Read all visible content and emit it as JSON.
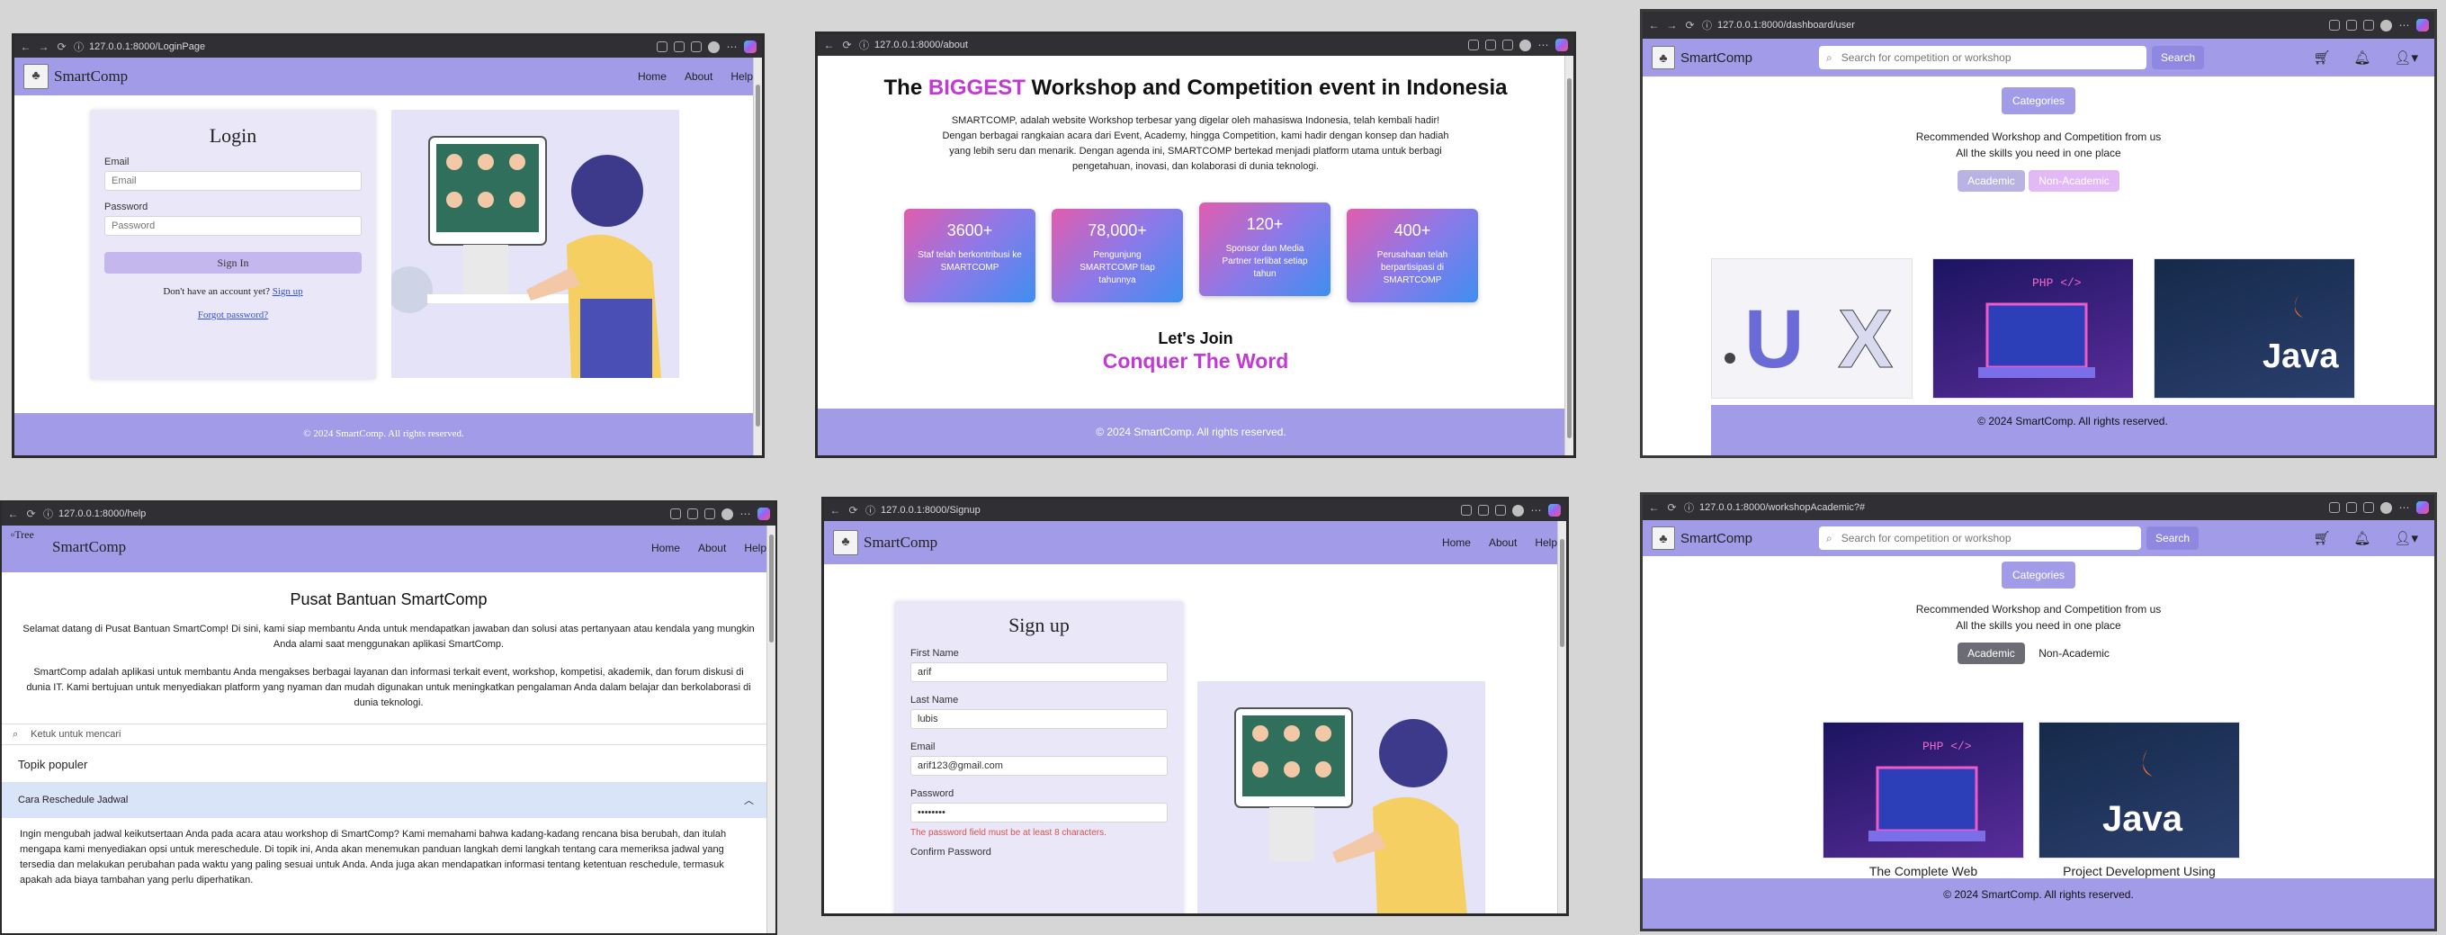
{
  "windows": {
    "login": {
      "url": "127.0.0.1:8000/LoginPage",
      "brand": "SmartComp",
      "nav": [
        "Home",
        "About",
        "Help"
      ],
      "title": "Login",
      "email_label": "Email",
      "email_placeholder": "Email",
      "password_label": "Password",
      "password_placeholder": "Password",
      "submit": "Sign In",
      "no_account": "Don't have an account yet?",
      "signup_link": "Sign up",
      "forgot": "Forgot password?",
      "footer": "© 2024 SmartComp. All rights reserved."
    },
    "about": {
      "url": "127.0.0.1:8000/about",
      "heading_pre": "The ",
      "heading_hl": "BIGGEST",
      "heading_post": " Workshop and Competition event in Indonesia",
      "paragraph": "SMARTCOMP, adalah website Workshop terbesar yang digelar oleh mahasiswa Indonesia, telah kembali hadir! Dengan berbagai rangkaian acara dari Event, Academy, hingga Competition, kami hadir dengan konsep dan hadiah yang lebih seru dan menarik. Dengan agenda ini, SMARTCOMP bertekad menjadi platform utama untuk berbagi pengetahuan, inovasi, dan kolaborasi di dunia teknologi.",
      "stats": [
        {
          "num": "3600+",
          "text": "Staf telah berkontribusi ke SMARTCOMP"
        },
        {
          "num": "78,000+",
          "text": "Pengunjung SMARTCOMP tiap tahunnya"
        },
        {
          "num": "120+",
          "text": "Sponsor dan Media Partner terlibat setiap tahun"
        },
        {
          "num": "400+",
          "text": "Perusahaan telah berpartisipasi di SMARTCOMP"
        }
      ],
      "join": "Let's Join",
      "conquer": "Conquer The Word",
      "footer": "© 2024 SmartComp. All rights reserved."
    },
    "dashboard": {
      "url": "127.0.0.1:8000/dashboard/user",
      "brand": "SmartComp",
      "search_placeholder": "Search for competition or workshop",
      "search_btn": "Search",
      "categories": "Categories",
      "rec1": "Recommended Workshop and Competition from us",
      "rec2": "All the skills you need in one place",
      "tab_academic": "Academic",
      "tab_nonacademic": "Non-Academic",
      "footer": "© 2024 SmartComp. All rights reserved."
    },
    "help": {
      "url": "127.0.0.1:8000/help",
      "logo_alt": "Tree",
      "brand": "SmartComp",
      "nav": [
        "Home",
        "About",
        "Help"
      ],
      "title": "Pusat Bantuan SmartComp",
      "p1": "Selamat datang di Pusat Bantuan SmartComp! Di sini, kami siap membantu Anda untuk mendapatkan jawaban dan solusi atas pertanyaan atau kendala yang mungkin Anda alami saat menggunakan aplikasi SmartComp.",
      "p2": "SmartComp adalah aplikasi untuk membantu Anda mengakses berbagai layanan dan informasi terkait event, workshop, kompetisi, akademik, dan forum diskusi di dunia IT. Kami bertujuan untuk menyediakan platform yang nyaman dan mudah digunakan untuk meningkatkan pengalaman Anda dalam belajar dan berkolaborasi di dunia teknologi.",
      "search_placeholder": "Ketuk untuk mencari",
      "popular": "Topik populer",
      "faq_title": "Cara Reschedule Jadwal",
      "faq_body": "Ingin mengubah jadwal keikutsertaan Anda pada acara atau workshop di SmartComp? Kami memahami bahwa kadang-kadang rencana bisa berubah, dan itulah mengapa kami menyediakan opsi untuk mereschedule. Di topik ini, Anda akan menemukan panduan langkah demi langkah tentang cara memeriksa jadwal yang tersedia dan melakukan perubahan pada waktu yang paling sesuai untuk Anda. Anda juga akan mendapatkan informasi tentang ketentuan reschedule, termasuk apakah ada biaya tambahan yang perlu diperhatikan."
    },
    "signup": {
      "url": "127.0.0.1:8000/Signup",
      "brand": "SmartComp",
      "nav": [
        "Home",
        "About",
        "Help"
      ],
      "title": "Sign up",
      "first_label": "First Name",
      "first_value": "arif",
      "last_label": "Last Name",
      "last_value": "lubis",
      "email_label": "Email",
      "email_value": "arif123@gmail.com",
      "password_label": "Password",
      "password_value": "••••••••",
      "error": "The password field must be at least 8 characters.",
      "confirm_label": "Confirm Password"
    },
    "academic": {
      "url": "127.0.0.1:8000/workshopAcademic?#",
      "brand": "SmartComp",
      "search_placeholder": "Search for competition or workshop",
      "search_btn": "Search",
      "categories": "Categories",
      "rec1": "Recommended Workshop and Competition from us",
      "rec2": "All the skills you need in one place",
      "tab_academic": "Academic",
      "tab_nonacademic": "Non-Academic",
      "card1": "The Complete Web",
      "card2": "Project Development Using",
      "footer": "© 2024 SmartComp. All rights reserved."
    }
  },
  "colors": {
    "nav": "#a29ce8",
    "accent": "#c23ad6",
    "error": "#d9534f"
  }
}
